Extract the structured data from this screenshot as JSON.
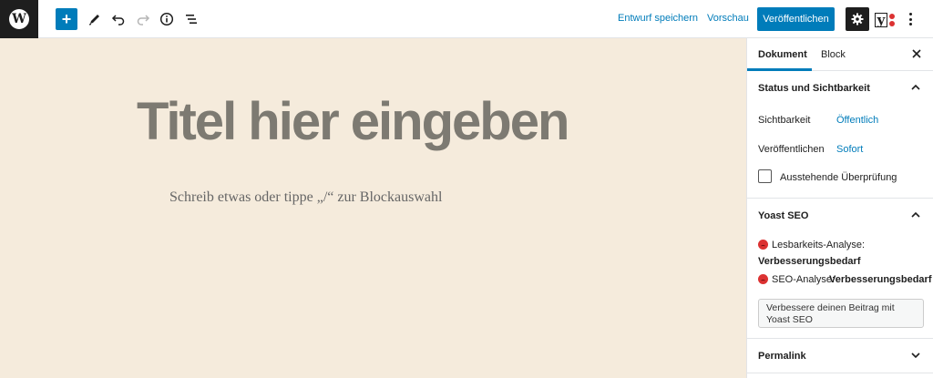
{
  "toolbar": {
    "save_draft": "Entwurf speichern",
    "preview": "Vorschau",
    "publish": "Veröffentlichen",
    "add_icon": "plus-icon",
    "accent": "#007cba"
  },
  "editor": {
    "title_placeholder": "Titel hier eingeben",
    "block_placeholder": "Schreib etwas oder tippe „/“ zur Blockauswahl",
    "background": "#f5ebdc"
  },
  "sidebar": {
    "tabs": [
      "Dokument",
      "Block"
    ],
    "status": {
      "title": "Status und Sichtbarkeit",
      "visibility_label": "Sichtbarkeit",
      "visibility_value": "Öffentlich",
      "publish_label": "Veröffentlichen",
      "publish_value": "Sofort",
      "pending_review": "Ausstehende Überprüfung"
    },
    "yoast": {
      "title": "Yoast SEO",
      "readability_label": "Lesbarkeits-Analyse:",
      "readability_value": "Verbesserungsbedarf",
      "seo_label": "SEO-Analyse:",
      "seo_value": "Verbesserungsbedarf",
      "improve_button": "Verbessere deinen Beitrag mit Yoast SEO"
    },
    "permalink": {
      "title": "Permalink"
    }
  }
}
